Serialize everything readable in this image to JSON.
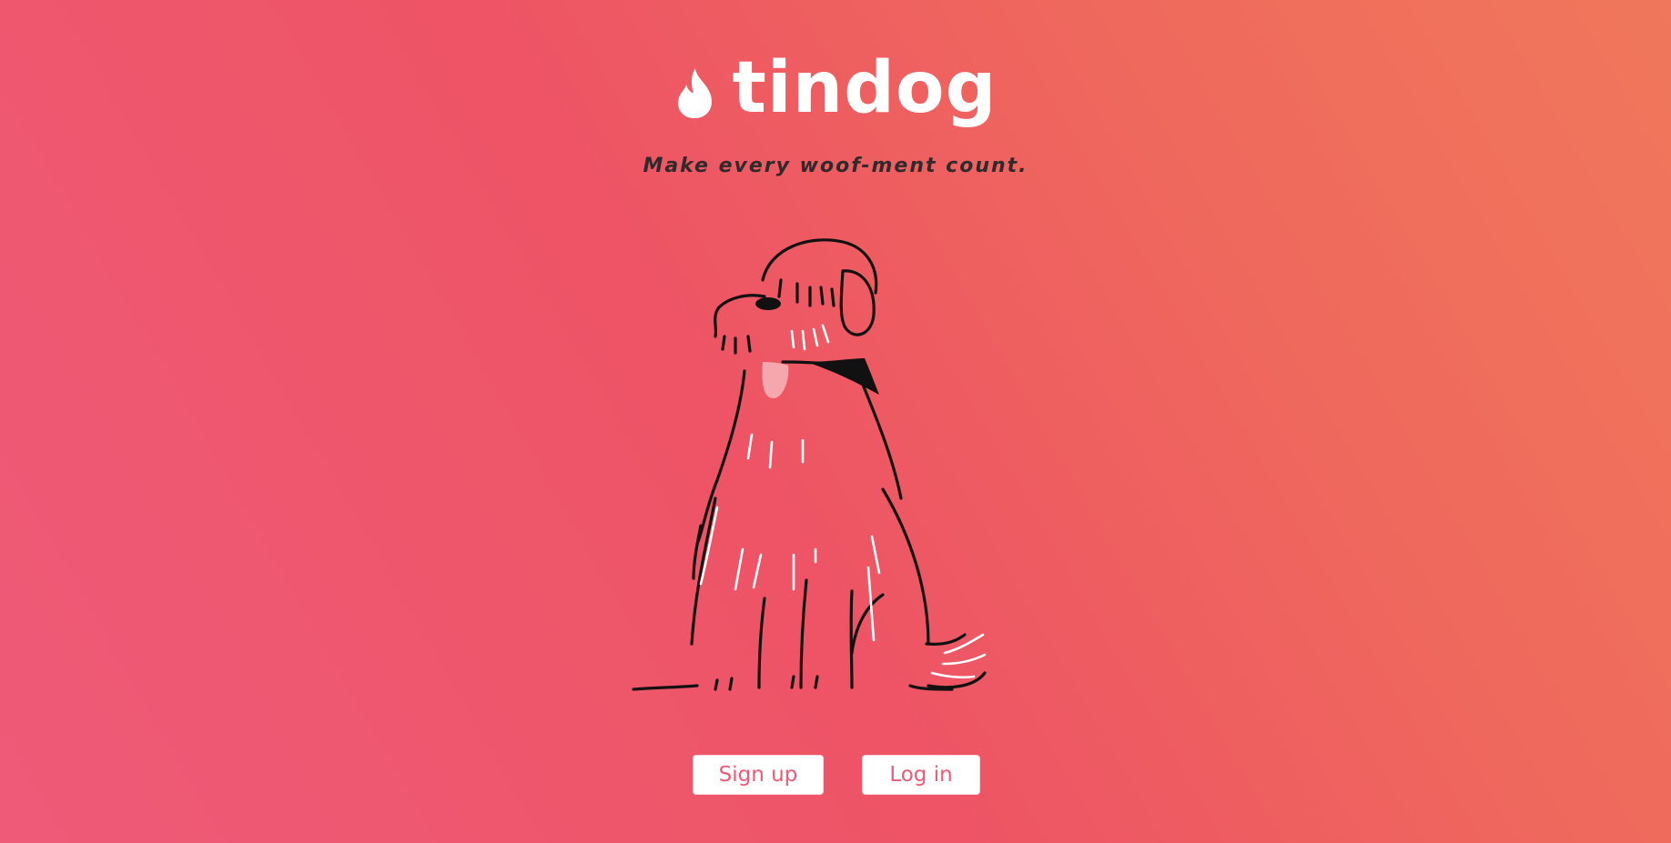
{
  "brand": {
    "logo_icon": "flame-icon",
    "title": "tindog",
    "tagline": "Make every woof-ment count."
  },
  "hero": {
    "illustration": "dog-illustration"
  },
  "actions": {
    "signup_label": "Sign up",
    "login_label": "Log in"
  },
  "colors": {
    "background_start": "#ee5a78",
    "background_end": "#f0775b",
    "text_white": "#ffffff",
    "tagline_text": "#2f2a2b",
    "button_text": "#ee5a78"
  }
}
